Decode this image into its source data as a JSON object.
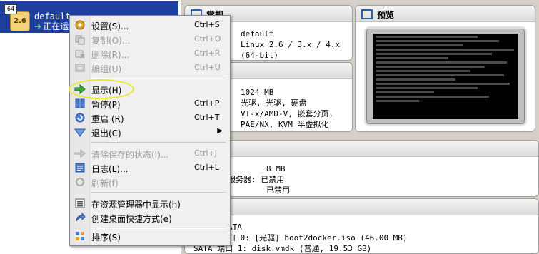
{
  "vm": {
    "badge": "64",
    "version": "2.6",
    "name": "default",
    "status": "正在运"
  },
  "general": {
    "title": "常规",
    "name": "default",
    "os_line1": "Linux 2.6 / 3.x / 4.x",
    "os_line2": "(64-bit)"
  },
  "system": {
    "memory": "1024 MB",
    "boot": "光驱, 光驱, 硬盘",
    "accel": "VT-x/AMD-V, 嵌套分页,",
    "accel2": "PAE/NX, KVM 半虚拟化"
  },
  "display": {
    "vram": "8 MB",
    "server_label": "服务器:",
    "server_value": "已禁用",
    "recording_value": "已禁用"
  },
  "storage": {
    "controller": "ATA",
    "port0_label": "口 0:",
    "port0_value": "[光驱] boot2docker.iso (46.00 MB)",
    "port1_label": "SATA 端口 1:",
    "port1_value": "disk.vmdk (普通, 19.53 GB)"
  },
  "preview": {
    "title": "预览"
  },
  "menu": {
    "items": [
      {
        "label": "设置(S)...",
        "shortcut": "Ctrl+S",
        "icon": "gear-icon",
        "disabled": false
      },
      {
        "label": "复制(O)...",
        "shortcut": "Ctrl+O",
        "icon": "clone-icon",
        "disabled": true
      },
      {
        "label": "删除(R)...",
        "shortcut": "Ctrl+R",
        "icon": "delete-icon",
        "disabled": true
      },
      {
        "label": "编组(U)",
        "shortcut": "Ctrl+U",
        "icon": "group-icon",
        "disabled": true
      },
      {
        "label": "显示(H)",
        "shortcut": "",
        "icon": "show-arrow-icon",
        "disabled": false
      },
      {
        "label": "暂停(P)",
        "shortcut": "Ctrl+P",
        "icon": "pause-icon",
        "disabled": false
      },
      {
        "label": "重启 (R)",
        "shortcut": "Ctrl+T",
        "icon": "restart-icon",
        "disabled": false
      },
      {
        "label": "退出(C)",
        "shortcut": "",
        "icon": "exit-icon",
        "disabled": false
      },
      {
        "label": "清除保存的状态(I)...",
        "shortcut": "Ctrl+J",
        "icon": "discard-state-icon",
        "disabled": true
      },
      {
        "label": "日志(L)...",
        "shortcut": "Ctrl+L",
        "icon": "log-icon",
        "disabled": false
      },
      {
        "label": "刷新(f)",
        "shortcut": "",
        "icon": "refresh-icon",
        "disabled": true
      },
      {
        "label": "在资源管理器中显示(h)",
        "shortcut": "",
        "icon": "explorer-icon",
        "disabled": false
      },
      {
        "label": "创建桌面快捷方式(e)",
        "shortcut": "",
        "icon": "shortcut-icon",
        "disabled": false
      },
      {
        "label": "排序(S)",
        "shortcut": "",
        "icon": "sort-icon",
        "disabled": false
      }
    ]
  },
  "colors": {
    "selection": "#1f3f9f",
    "highlight_ring": "#e8e830"
  }
}
